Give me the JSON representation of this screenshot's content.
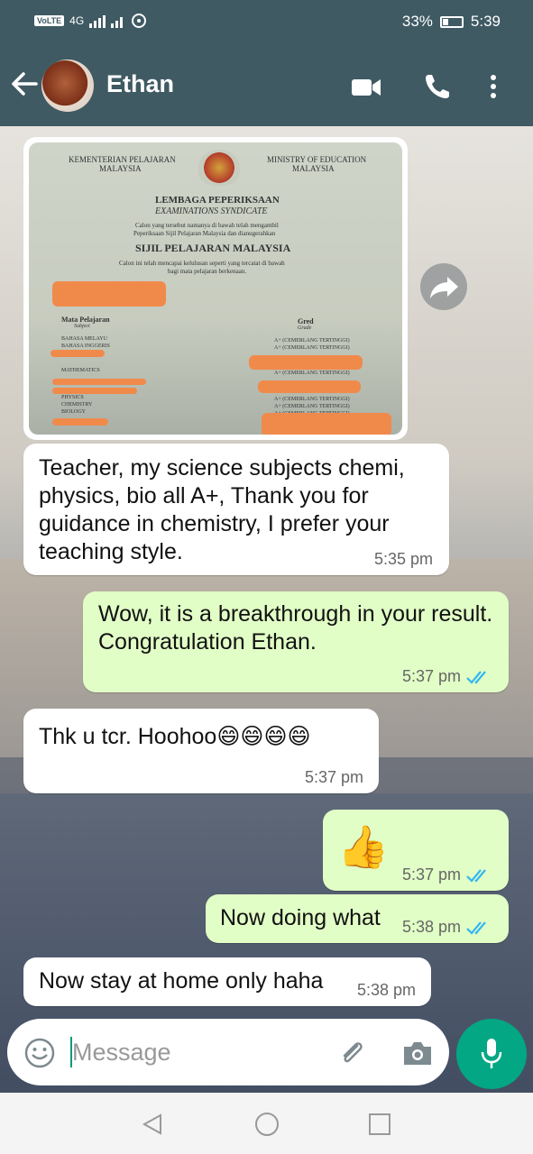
{
  "status_bar": {
    "network": "VoLTE",
    "signal": "4G",
    "battery": "33%",
    "time": "5:39"
  },
  "header": {
    "contact_name": "Ethan"
  },
  "certificate": {
    "ministry_ms": "KEMENTERIAN PELAJARAN",
    "country_ms": "MALAYSIA",
    "ministry_en": "MINISTRY OF EDUCATION",
    "country_en": "MALAYSIA",
    "board_ms": "LEMBAGA PEPERIKSAAN",
    "board_en": "EXAMINATIONS SYNDICATE",
    "line1": "Calon yang tersebut namanya di bawah telah mengambil",
    "line2": "Peperiksaan Sijil Pelajaran Malaysia dan dianugerahkan",
    "title": "SIJIL PELAJARAN MALAYSIA",
    "line3": "Calon ini telah mencapai kelulusan seperti yang tercatat di bawah",
    "line4": "bagi mata pelajaran berkenaan.",
    "subject_head": "Mata Pelajaran",
    "subject_sub": "Subject",
    "grade_head": "Gred",
    "grade_sub": "Grade",
    "subjects": [
      "BAHASA MELAYU",
      "BAHASA INGGERIS",
      "MATHEMATICS",
      "PHYSICS",
      "CHEMISTRY",
      "BIOLOGY"
    ],
    "grade": "A+ (CEMERLANG TERTINGGI)"
  },
  "messages": [
    {
      "text": "Teacher, my science subjects chemi, physics, bio all A+, Thank you for guidance in chemistry, I prefer your teaching style.",
      "time": "5:35 pm"
    },
    {
      "text": "Wow, it is a breakthrough in your result. Congratulation Ethan.",
      "time": "5:37 pm"
    },
    {
      "text": "Thk u tcr. Hoohoo😄😄😄😄",
      "time": "5:37 pm"
    },
    {
      "text": "👍",
      "time": "5:37 pm"
    },
    {
      "text": "Now doing what",
      "time": "5:38 pm"
    },
    {
      "text": "Now stay at home only haha",
      "time": "5:38 pm"
    }
  ],
  "composer": {
    "placeholder": "Message"
  },
  "colors": {
    "header": "#3f5a63",
    "outgoing_bubble": "#e1fec6",
    "incoming_bubble": "#ffffff",
    "accent": "#03a784",
    "read_ticks": "#34b7f1"
  }
}
